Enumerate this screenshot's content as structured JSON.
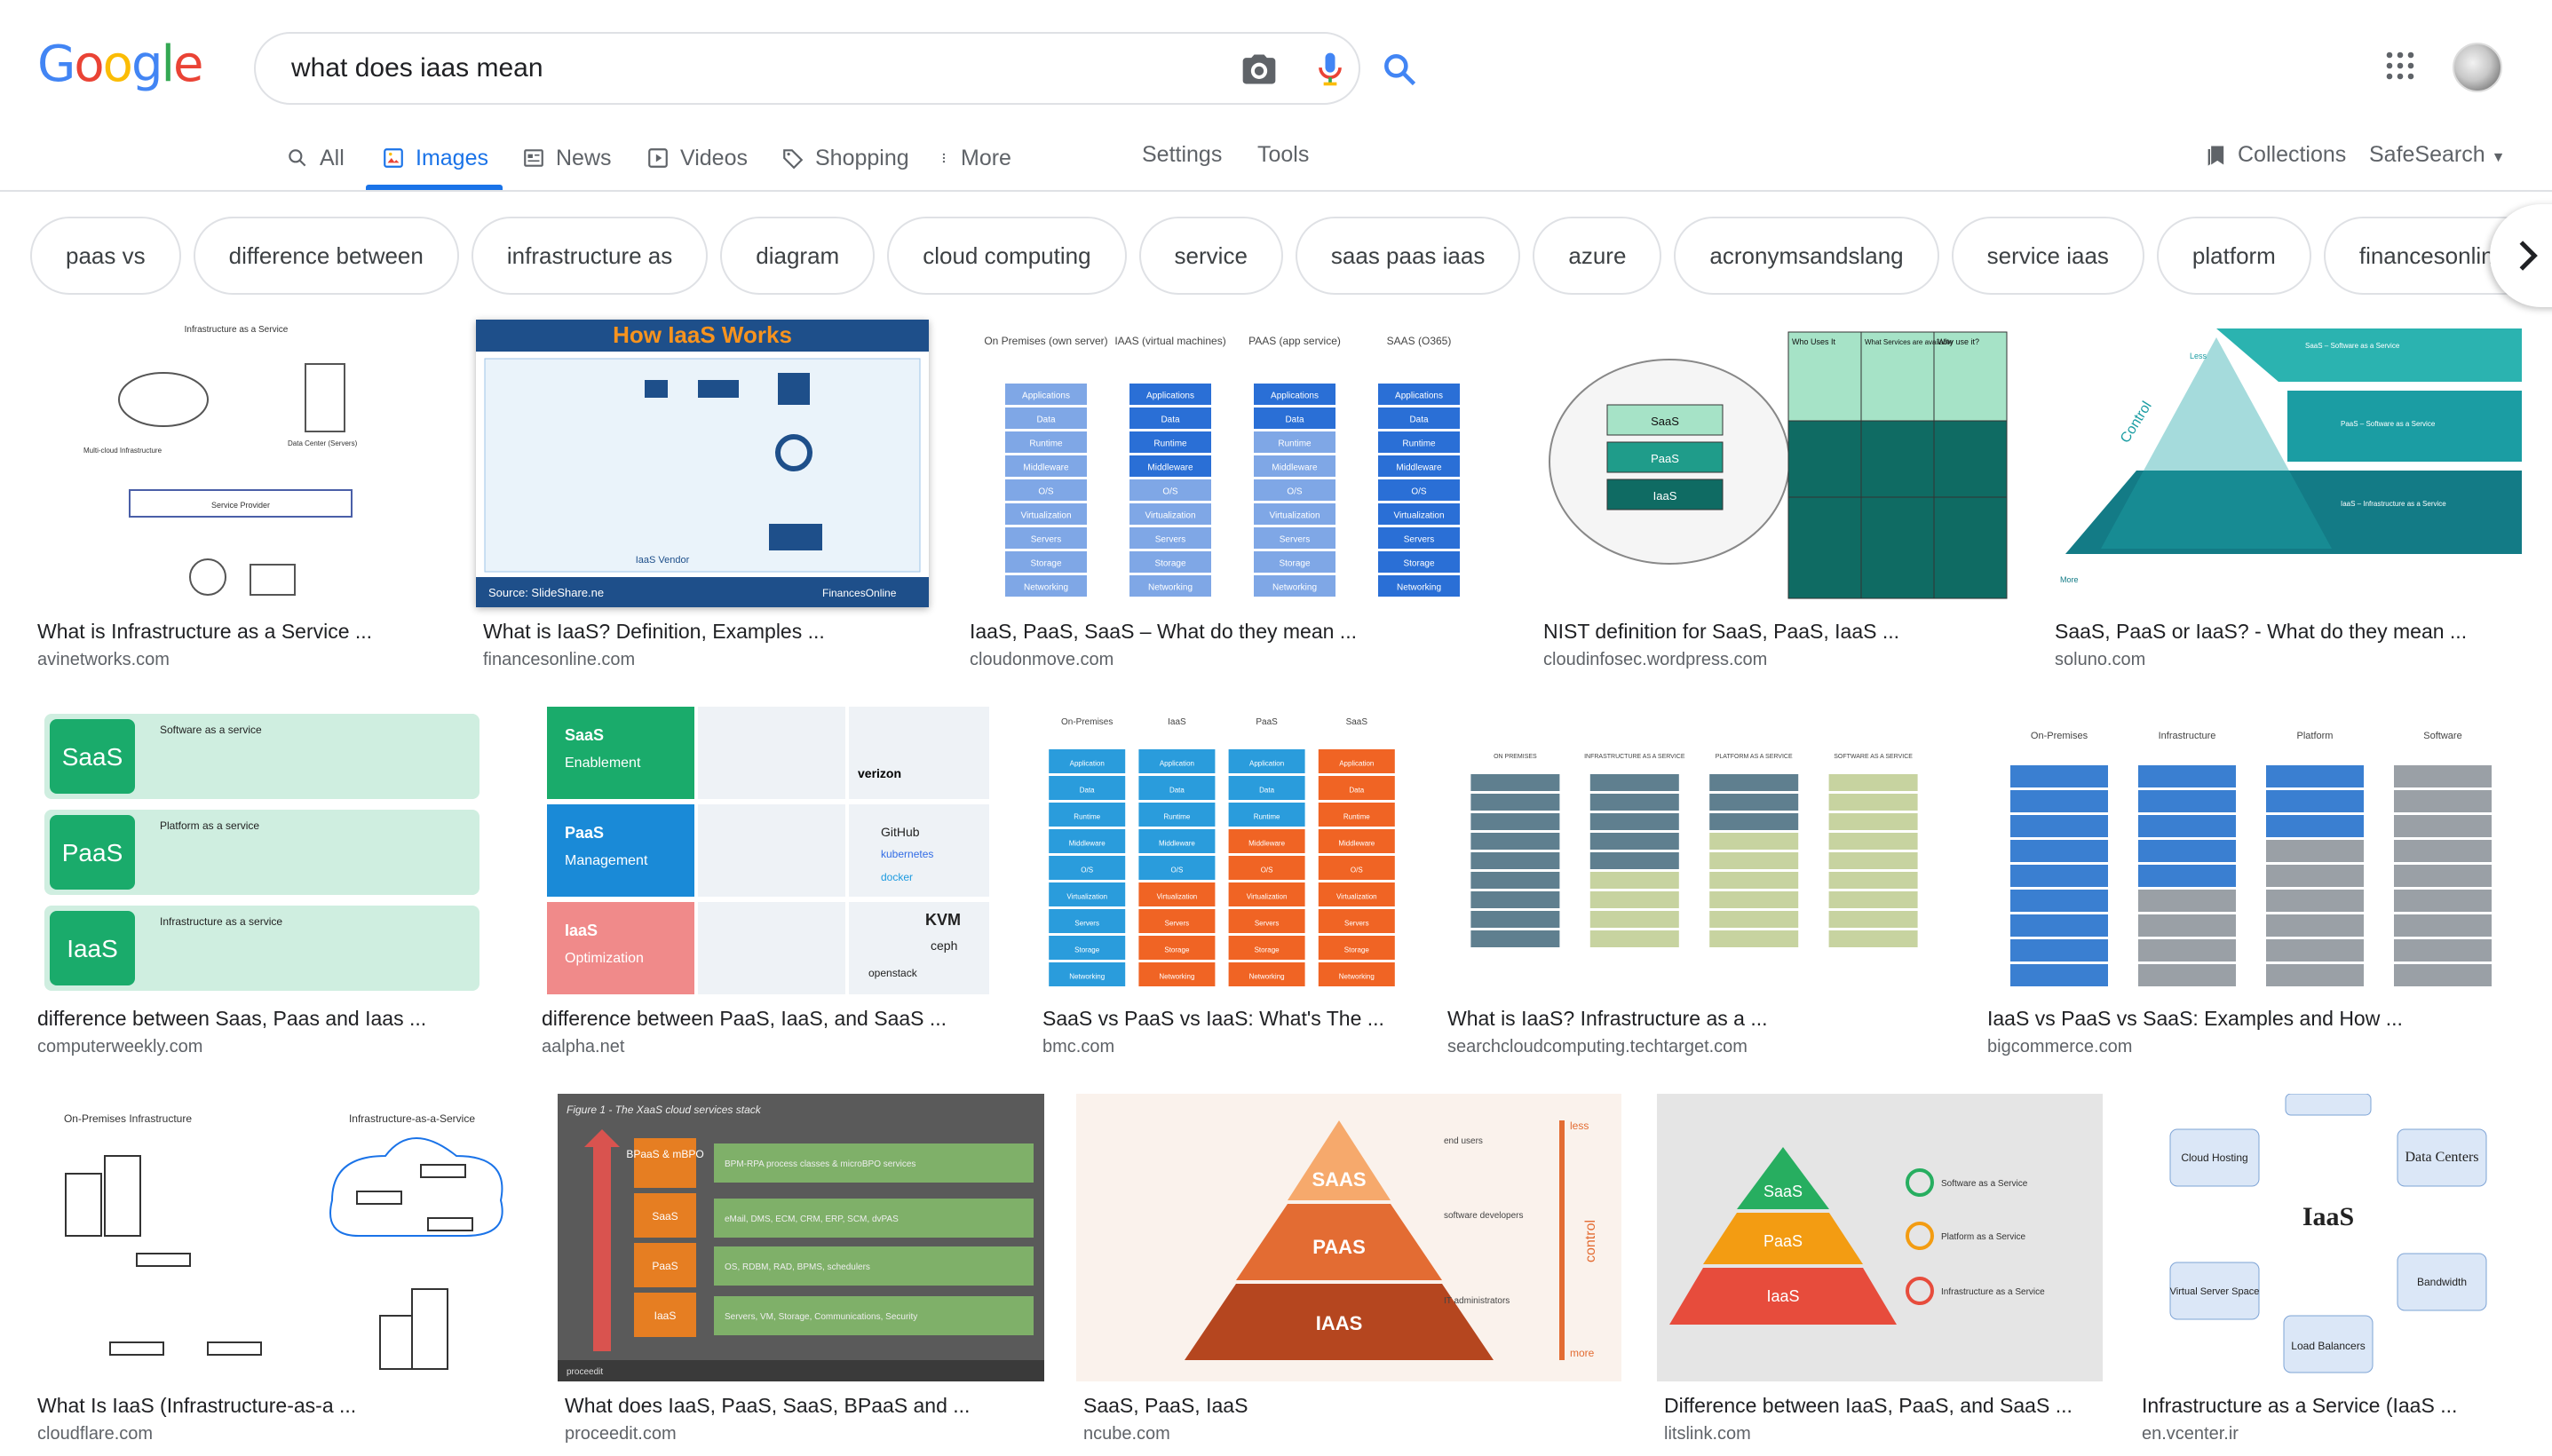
{
  "logo": "Google",
  "search": {
    "query": "what does iaas mean"
  },
  "tabs": [
    {
      "label": "All"
    },
    {
      "label": "Images"
    },
    {
      "label": "News"
    },
    {
      "label": "Videos"
    },
    {
      "label": "Shopping"
    },
    {
      "label": "More"
    }
  ],
  "tools": {
    "settings": "Settings",
    "tools": "Tools",
    "collections": "Collections",
    "safesearch": "SafeSearch"
  },
  "chips": [
    "paas vs",
    "difference between",
    "infrastructure as",
    "diagram",
    "cloud computing",
    "service",
    "saas paas iaas",
    "azure",
    "acronymsandslang",
    "service iaas",
    "platform",
    "financesonline"
  ],
  "results": [
    {
      "title": "What is Infrastructure as a Service ...",
      "source": "avinetworks.com",
      "thumb": {
        "heading": "Infrastructure as a Service",
        "labels": [
          "Multi-cloud Infrastructure",
          "Data Center (Servers)",
          "Service Provider"
        ]
      }
    },
    {
      "title": "What is IaaS? Definition, Examples ...",
      "source": "financesonline.com",
      "thumb": {
        "heading": "How IaaS Works",
        "labels": [
          "IaaS Vendor",
          "Source: SlideShare.ne",
          "FinancesOnline"
        ]
      }
    },
    {
      "title": "IaaS, PaaS, SaaS – What do they mean ...",
      "source": "cloudonmove.com",
      "thumb": {
        "heading": "",
        "columns": [
          "On Premises (own server)",
          "IAAS (virtual machines)",
          "PAAS (app service)",
          "SAAS (O365)"
        ],
        "rows": [
          "Applications",
          "Data",
          "Runtime",
          "Middleware",
          "O/S",
          "Virtualization",
          "Servers",
          "Storage",
          "Networking"
        ]
      }
    },
    {
      "title": "NIST definition for SaaS, PaaS, IaaS ...",
      "source": "cloudinfosec.wordpress.com",
      "thumb": {
        "heading": "",
        "labels": [
          "SaaS",
          "PaaS",
          "IaaS",
          "Who Uses It",
          "What Services are available",
          "Why use it?"
        ]
      }
    },
    {
      "title": "SaaS, PaaS or IaaS? - What do they mean ...",
      "source": "soluno.com",
      "thumb": {
        "heading": "",
        "labels": [
          "Control",
          "Less",
          "More",
          "SaaS – Software as a Service",
          "PaaS – Software as a Service",
          "IaaS – Infrastructure as a Service"
        ]
      }
    },
    {
      "title": "difference between Saas, Paas and Iaas ...",
      "source": "computerweekly.com",
      "thumb": {
        "heading": "",
        "labels": [
          "SaaS",
          "PaaS",
          "IaaS",
          "Software as a service",
          "Platform as a service",
          "Infrastructure as a service"
        ]
      }
    },
    {
      "title": "difference between PaaS, IaaS, and SaaS ...",
      "source": "aalpha.net",
      "thumb": {
        "heading": "",
        "labels": [
          "SaaS",
          "Enablement",
          "PaaS",
          "Management",
          "IaaS",
          "Optimization",
          "GitHub",
          "kubernetes",
          "docker",
          "verizon",
          "KVM",
          "ceph",
          "openstack"
        ]
      }
    },
    {
      "title": "SaaS vs PaaS vs IaaS: What's The ...",
      "source": "bmc.com",
      "thumb": {
        "heading": "",
        "columns": [
          "On-Premises",
          "IaaS",
          "PaaS",
          "SaaS"
        ],
        "rows": [
          "Application",
          "Data",
          "Runtime",
          "Middleware",
          "O/S",
          "Virtualization",
          "Servers",
          "Storage",
          "Networking"
        ]
      }
    },
    {
      "title": "What is IaaS? Infrastructure as a ...",
      "source": "searchcloudcomputing.techtarget.com",
      "thumb": {
        "heading": "",
        "columns": [
          "ON PREMISES",
          "INFRASTRUCTURE AS A SERVICE",
          "PLATFORM AS A SERVICE",
          "SOFTWARE AS A SERVICE"
        ]
      }
    },
    {
      "title": "IaaS vs PaaS vs SaaS: Examples and How ...",
      "source": "bigcommerce.com",
      "thumb": {
        "heading": "",
        "columns": [
          "On-Premises",
          "Infrastructure",
          "Platform",
          "Software"
        ]
      }
    },
    {
      "title": "What Is IaaS (Infrastructure-as-a ...",
      "source": "cloudflare.com",
      "thumb": {
        "heading": "",
        "labels": [
          "On-Premises Infrastructure",
          "Infrastructure-as-a-Service"
        ]
      }
    },
    {
      "title": "What does IaaS, PaaS, SaaS, BPaaS and ...",
      "source": "proceedit.com",
      "thumb": {
        "heading": "Figure 1 - The XaaS cloud services stack",
        "labels": [
          "BPaaS & mBPO",
          "SaaS",
          "PaaS",
          "IaaS",
          "BPM-RPA process classes & microBPO services",
          "eMail, DMS, ECM, CRM, ERP, SCM, dvPAS",
          "OS, RDBM, RAD, BPMS, schedulers",
          "Servers, VM, Storage, Communications, Security",
          "proceedit"
        ]
      }
    },
    {
      "title": "SaaS, PaaS, IaaS",
      "source": "ncube.com",
      "thumb": {
        "heading": "",
        "labels": [
          "SAAS",
          "PAAS",
          "IAAS",
          "less",
          "control",
          "more",
          "end users",
          "software developers",
          "IT administrators"
        ]
      }
    },
    {
      "title": "Difference between IaaS, PaaS, and SaaS ...",
      "source": "litslink.com",
      "thumb": {
        "heading": "",
        "labels": [
          "SaaS",
          "PaaS",
          "IaaS",
          "Software as a Service",
          "Platform as a Service",
          "Infrastructure as a Service"
        ]
      }
    },
    {
      "title": "Infrastructure as a Service (IaaS ...",
      "source": "en.vcenter.ir",
      "thumb": {
        "heading": "IaaS",
        "labels": [
          "Cloud Hosting",
          "Data Centers",
          "Virtual Server Space",
          "Bandwidth",
          "Load Balancers"
        ]
      }
    }
  ],
  "colors": {
    "accent": "#1a73e8",
    "muted": "#5f6368",
    "border": "#dfe1e5"
  }
}
